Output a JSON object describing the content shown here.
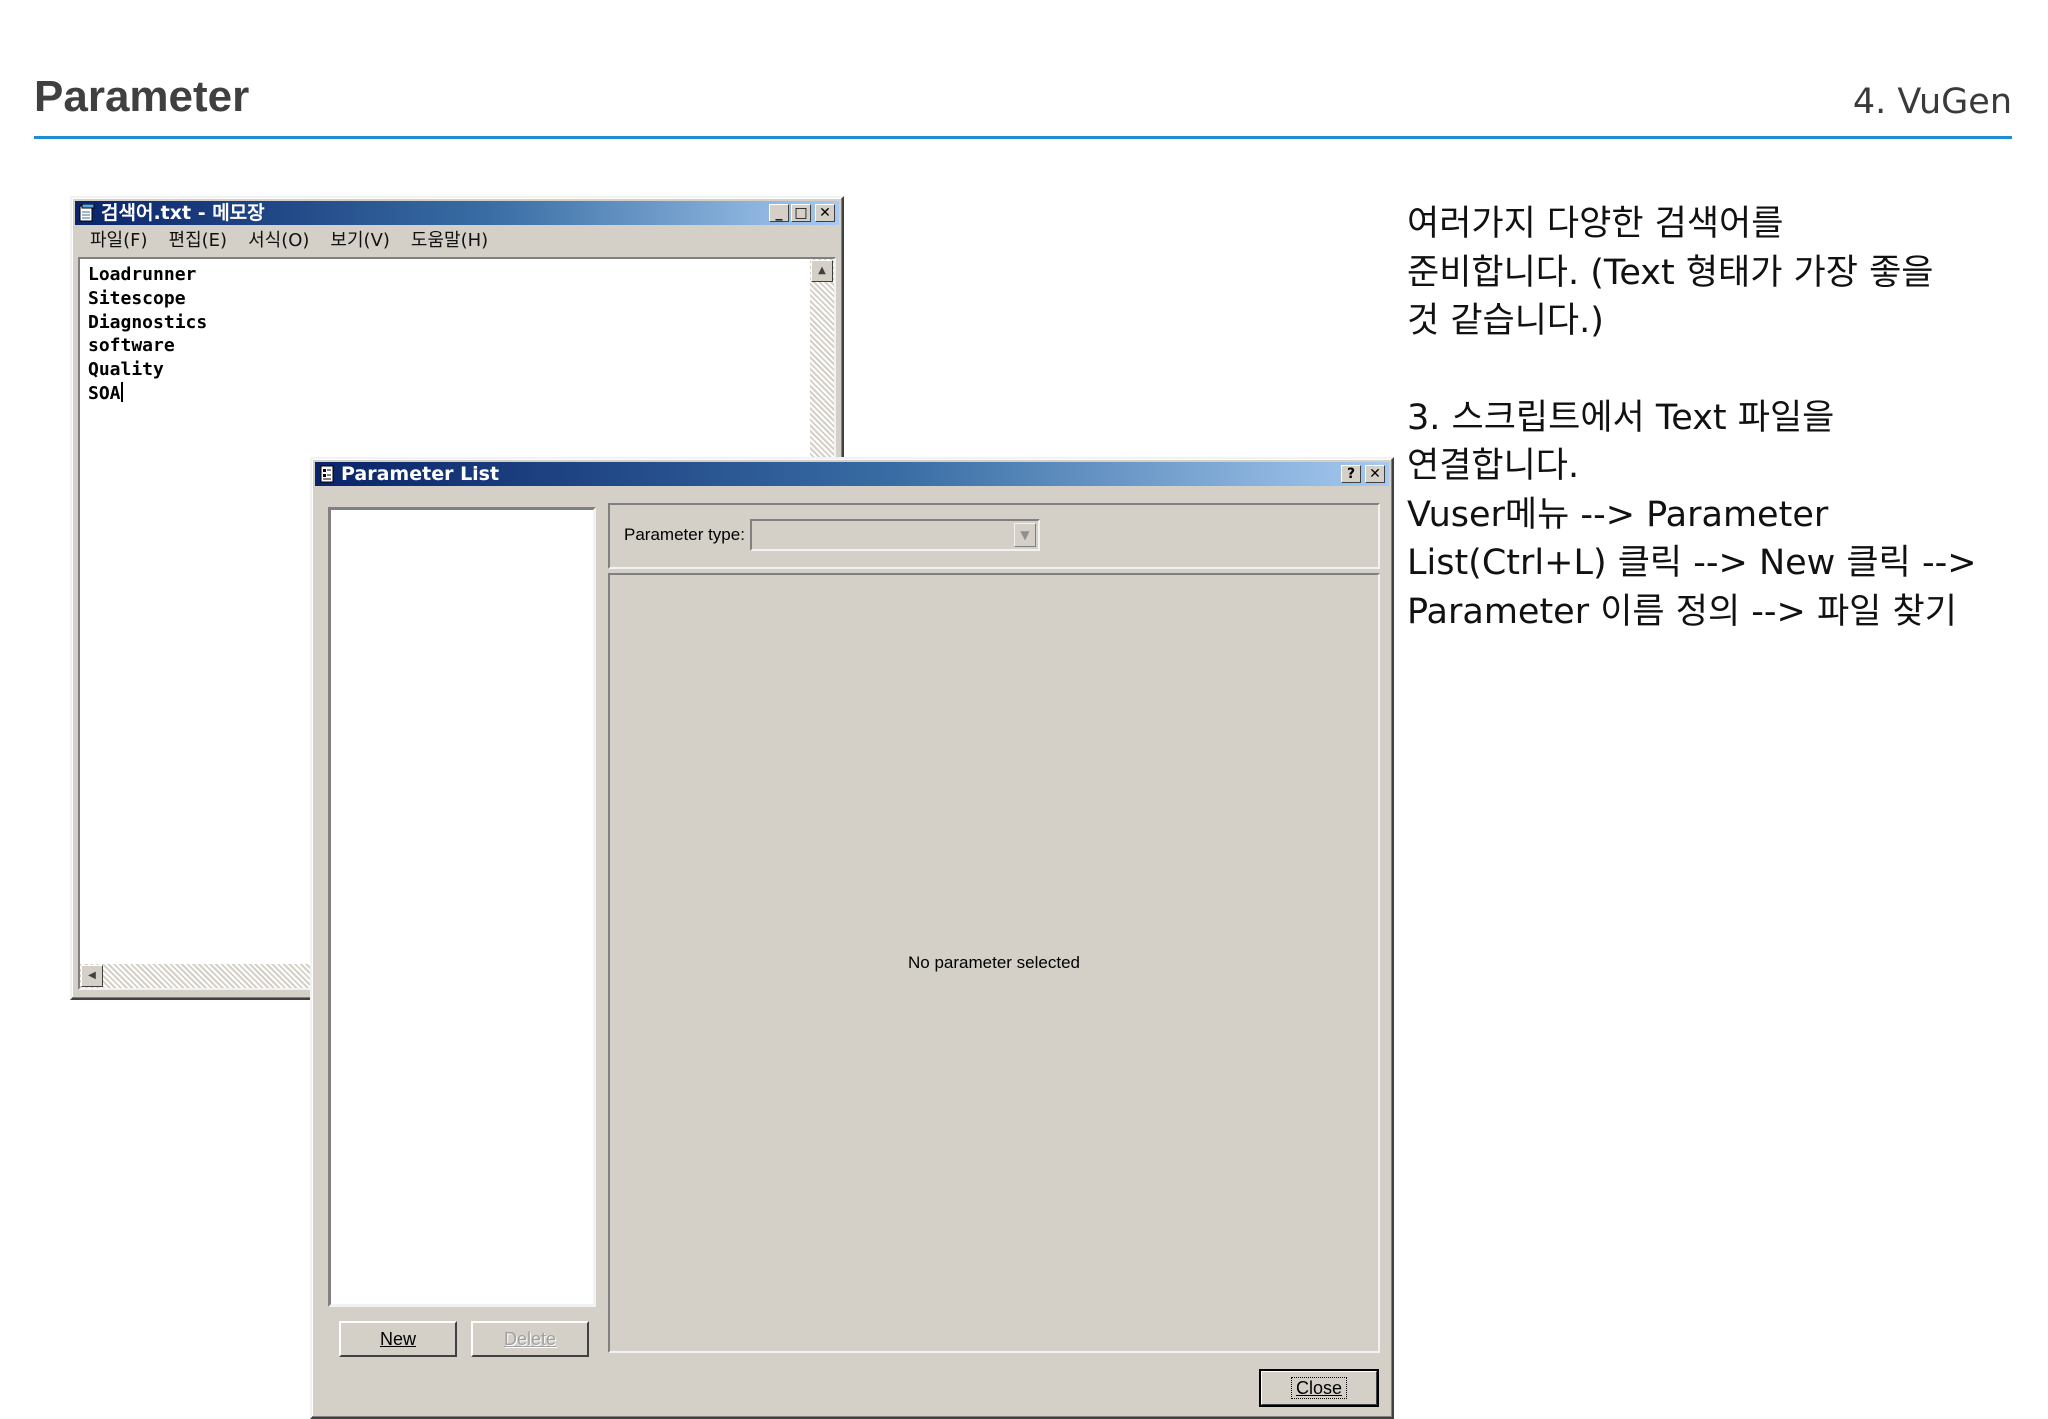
{
  "slide": {
    "title": "Parameter",
    "section": "4. VuGen",
    "accent_color": "#1f8ed2"
  },
  "explanation": {
    "para1_line1": "여러가지 다양한 검색어를",
    "para1_line2": "준비합니다. (Text 형태가 가장 좋을",
    "para1_line3": "것 같습니다.)",
    "para2_line1": "3. 스크립트에서 Text 파일을",
    "para2_line2": "연결합니다.",
    "para2_line3": "Vuser메뉴  --> Parameter",
    "para2_line4": "List(Ctrl+L) 클릭 --> New 클릭 -->",
    "para2_line5": "Parameter 이름 정의 --> 파일 찾기"
  },
  "notepad": {
    "title": "검색어.txt - 메모장",
    "menus": [
      "파일(F)",
      "편집(E)",
      "서식(O)",
      "보기(V)",
      "도움말(H)"
    ],
    "lines": [
      "Loadrunner",
      "Sitescope",
      "Diagnostics",
      "software",
      "Quality",
      "SOA"
    ]
  },
  "parameter_list": {
    "title": "Parameter List",
    "help_btn": "?",
    "close_x": "✕",
    "parameter_type_label": "Parameter type:",
    "parameter_type_value": "",
    "empty_message": "No parameter selected",
    "new_label": "New",
    "delete_label": "Delete",
    "close_label": "Close"
  }
}
